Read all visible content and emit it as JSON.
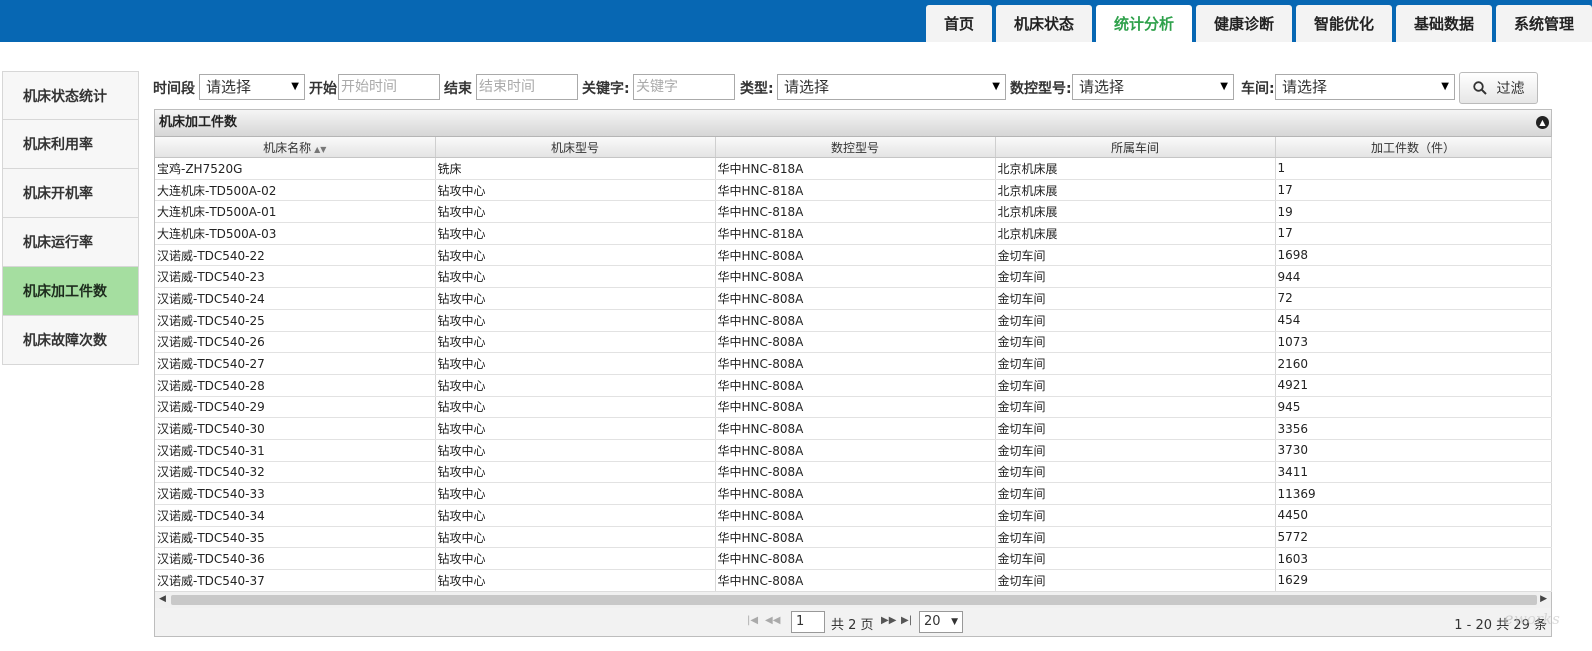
{
  "nav": {
    "tabs": [
      {
        "label": "首页",
        "active": false
      },
      {
        "label": "机床状态",
        "active": false
      },
      {
        "label": "统计分析",
        "active": true
      },
      {
        "label": "健康诊断",
        "active": false
      },
      {
        "label": "智能优化",
        "active": false
      },
      {
        "label": "基础数据",
        "active": false
      },
      {
        "label": "系统管理",
        "active": false
      }
    ]
  },
  "sidebar": {
    "items": [
      {
        "label": "机床状态统计",
        "active": false
      },
      {
        "label": "机床利用率",
        "active": false
      },
      {
        "label": "机床开机率",
        "active": false
      },
      {
        "label": "机床运行率",
        "active": false
      },
      {
        "label": "机床加工件数",
        "active": true
      },
      {
        "label": "机床故障次数",
        "active": false
      }
    ]
  },
  "filter": {
    "period_label": "时间段",
    "period_value": "请选择",
    "start_label": "开始",
    "start_placeholder": "开始时间",
    "end_label": "结束",
    "end_placeholder": "结束时间",
    "keyword_label": "关键字:",
    "keyword_placeholder": "关键字",
    "type_label": "类型:",
    "type_value": "请选择",
    "cnc_label": "数控型号:",
    "cnc_value": "请选择",
    "workshop_label": "车间:",
    "workshop_value": "请选择",
    "filter_button": "过滤"
  },
  "grid": {
    "title": "机床加工件数",
    "columns": [
      "机床名称",
      "机床型号",
      "数控型号",
      "所属车间",
      "加工件数（件）"
    ],
    "rows": [
      [
        "宝鸡-ZH7520G",
        "铣床",
        "华中HNC-818A",
        "北京机床展",
        "1"
      ],
      [
        "大连机床-TD500A-02",
        "钻攻中心",
        "华中HNC-818A",
        "北京机床展",
        "17"
      ],
      [
        "大连机床-TD500A-01",
        "钻攻中心",
        "华中HNC-818A",
        "北京机床展",
        "19"
      ],
      [
        "大连机床-TD500A-03",
        "钻攻中心",
        "华中HNC-818A",
        "北京机床展",
        "17"
      ],
      [
        "汉诺威-TDC540-22",
        "钻攻中心",
        "华中HNC-808A",
        "金切车间",
        "1698"
      ],
      [
        "汉诺威-TDC540-23",
        "钻攻中心",
        "华中HNC-808A",
        "金切车间",
        "944"
      ],
      [
        "汉诺威-TDC540-24",
        "钻攻中心",
        "华中HNC-808A",
        "金切车间",
        "72"
      ],
      [
        "汉诺威-TDC540-25",
        "钻攻中心",
        "华中HNC-808A",
        "金切车间",
        "454"
      ],
      [
        "汉诺威-TDC540-26",
        "钻攻中心",
        "华中HNC-808A",
        "金切车间",
        "1073"
      ],
      [
        "汉诺威-TDC540-27",
        "钻攻中心",
        "华中HNC-808A",
        "金切车间",
        "2160"
      ],
      [
        "汉诺威-TDC540-28",
        "钻攻中心",
        "华中HNC-808A",
        "金切车间",
        "4921"
      ],
      [
        "汉诺威-TDC540-29",
        "钻攻中心",
        "华中HNC-808A",
        "金切车间",
        "945"
      ],
      [
        "汉诺威-TDC540-30",
        "钻攻中心",
        "华中HNC-808A",
        "金切车间",
        "3356"
      ],
      [
        "汉诺威-TDC540-31",
        "钻攻中心",
        "华中HNC-808A",
        "金切车间",
        "3730"
      ],
      [
        "汉诺威-TDC540-32",
        "钻攻中心",
        "华中HNC-808A",
        "金切车间",
        "3411"
      ],
      [
        "汉诺威-TDC540-33",
        "钻攻中心",
        "华中HNC-808A",
        "金切车间",
        "11369"
      ],
      [
        "汉诺威-TDC540-34",
        "钻攻中心",
        "华中HNC-808A",
        "金切车间",
        "4450"
      ],
      [
        "汉诺威-TDC540-35",
        "钻攻中心",
        "华中HNC-808A",
        "金切车间",
        "5772"
      ],
      [
        "汉诺威-TDC540-36",
        "钻攻中心",
        "华中HNC-808A",
        "金切车间",
        "1603"
      ],
      [
        "汉诺威-TDC540-37",
        "钻攻中心",
        "华中HNC-808A",
        "金切车间",
        "1629"
      ]
    ]
  },
  "pager": {
    "current_page": "1",
    "total_pages": "共 2 页",
    "page_size": "20",
    "range": "1 - 20 共 29 条"
  },
  "colors": {
    "header_blue": "#0767b3",
    "active_tab_text": "#2fa14b",
    "active_sidebar": "#a5dea0"
  }
}
